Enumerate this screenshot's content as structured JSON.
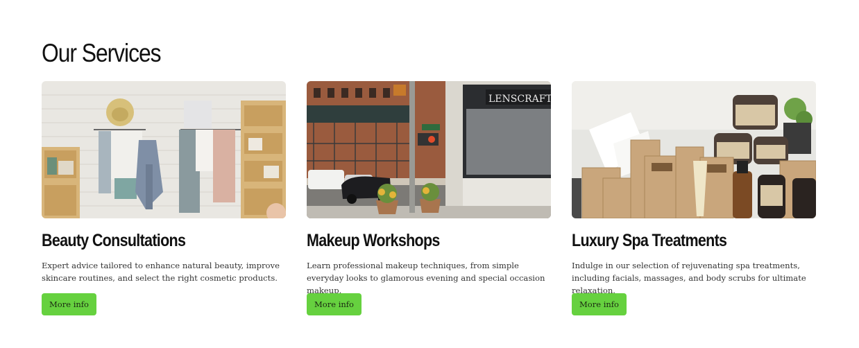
{
  "section": {
    "title": "Our Services"
  },
  "cards": [
    {
      "title": "Beauty Consultations",
      "description": "Expert advice tailored to enhance natural beauty, improve skincare routines, and select the right cosmetic products.",
      "button_label": "More info",
      "image_subject": "boutique with hanging towels, robe and straw hat on white brick wall"
    },
    {
      "title": "Makeup Workshops",
      "description": "Learn professional makeup techniques, from simple everyday looks to glamorous evening and special occasion makeup.",
      "button_label": "More info",
      "image_subject": "city street corner with storefront, traffic lights and planters",
      "image_sign_text": "LENSCRAFT"
    },
    {
      "title": "Luxury Spa Treatments",
      "description": "Indulge in our selection of rejuvenating spa treatments, including facials, massages, and body scrubs for ultimate relaxation.",
      "button_label": "More info",
      "image_subject": "kraft paper boxes, jars and dropper bottles of spa products"
    }
  ],
  "colors": {
    "button_bg": "#66d13f",
    "heading": "#111111",
    "text": "#333333",
    "background": "#ffffff"
  }
}
